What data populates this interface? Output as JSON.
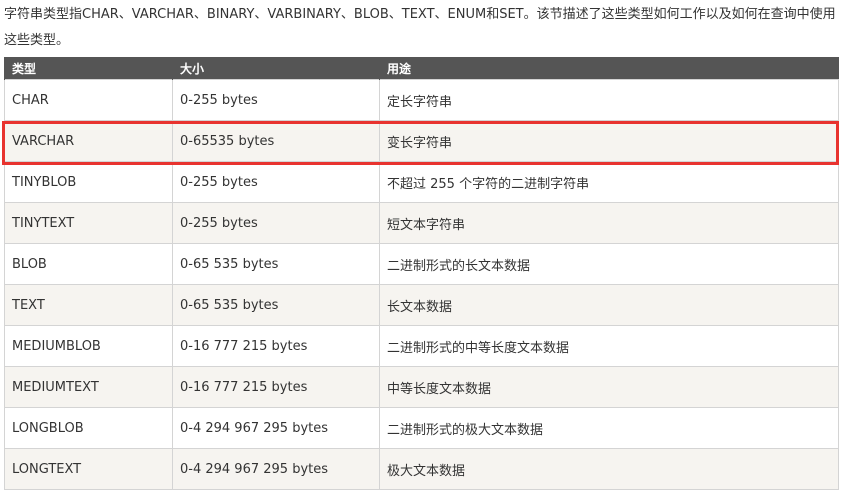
{
  "intro": {
    "text": "字符串类型指CHAR、VARCHAR、BINARY、VARBINARY、BLOB、TEXT、ENUM和SET。该节描述了这些类型如何工作以及如何在查询中使用这些类型。"
  },
  "table": {
    "headers": [
      "类型",
      "大小",
      "用途"
    ],
    "rows": [
      [
        "CHAR",
        "0-255 bytes",
        "定长字符串"
      ],
      [
        "VARCHAR",
        "0-65535 bytes",
        "变长字符串"
      ],
      [
        "TINYBLOB",
        "0-255 bytes",
        "不超过 255 个字符的二进制字符串"
      ],
      [
        "TINYTEXT",
        "0-255 bytes",
        "短文本字符串"
      ],
      [
        "BLOB",
        "0-65 535 bytes",
        "二进制形式的长文本数据"
      ],
      [
        "TEXT",
        "0-65 535 bytes",
        "长文本数据"
      ],
      [
        "MEDIUMBLOB",
        "0-16 777 215 bytes",
        "二进制形式的中等长度文本数据"
      ],
      [
        "MEDIUMTEXT",
        "0-16 777 215 bytes",
        "中等长度文本数据"
      ],
      [
        "LONGBLOB",
        "0-4 294 967 295 bytes",
        "二进制形式的极大文本数据"
      ],
      [
        "LONGTEXT",
        "0-4 294 967 295 bytes",
        "极大文本数据"
      ]
    ]
  },
  "colors": {
    "header_bg": "#555555",
    "alt_row_bg": "#f6f4f0",
    "highlight_border": "#e8332f"
  }
}
